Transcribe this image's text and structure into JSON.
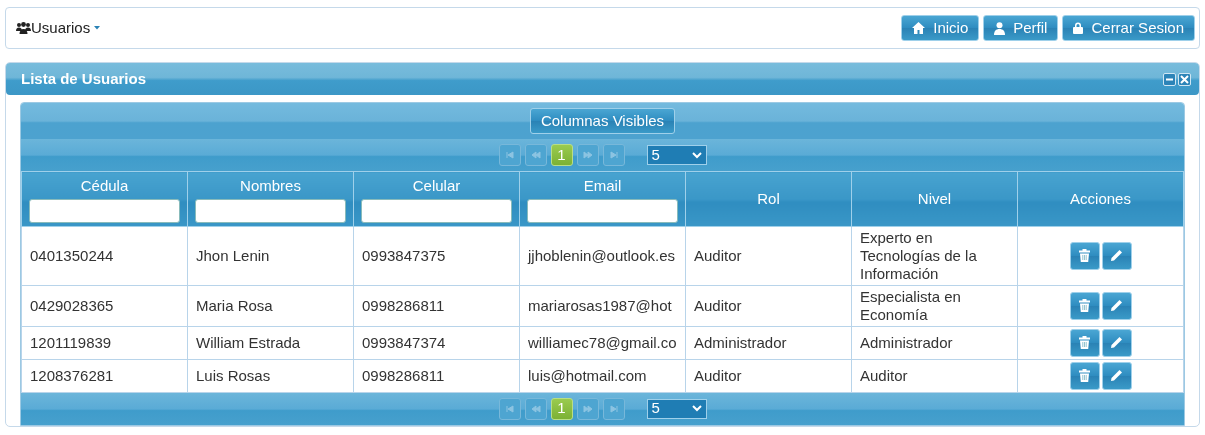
{
  "topbar": {
    "menu": {
      "label": "Usuarios"
    },
    "buttons": [
      {
        "kind": "home",
        "label": "Inicio"
      },
      {
        "kind": "user",
        "label": "Perfil"
      },
      {
        "kind": "lock",
        "label": "Cerrar Sesion"
      }
    ]
  },
  "panel": {
    "title": "Lista de Usuarios",
    "controls": [
      {
        "kind": "minimize"
      },
      {
        "kind": "close"
      }
    ]
  },
  "grid": {
    "toolbar_button": "Columnas Visibles",
    "top_pager": {
      "pages": [
        {
          "label": "1",
          "selected": true
        }
      ],
      "page_size": "5"
    },
    "columns": [
      {
        "label": "Cédula",
        "filter": true
      },
      {
        "label": "Nombres",
        "filter": true
      },
      {
        "label": "Celular",
        "filter": true
      },
      {
        "label": "Email",
        "filter": true
      },
      {
        "label": "Rol",
        "filter": false
      },
      {
        "label": "Nivel",
        "filter": false
      },
      {
        "label": "Acciones",
        "filter": false
      }
    ],
    "rows": [
      {
        "cells": [
          "0401350244",
          "Jhon Lenin",
          "0993847375",
          "jjhoblenin@outlook.es",
          "Auditor",
          "Experto en Tecnologías de la Información"
        ],
        "actions": [
          {
            "kind": "delete"
          },
          {
            "kind": "edit"
          }
        ]
      },
      {
        "cells": [
          "0429028365",
          "Maria Rosa",
          "0998286811",
          "mariarosas1987@hot",
          "Auditor",
          "Especialista en Economía"
        ],
        "actions": [
          {
            "kind": "delete"
          },
          {
            "kind": "edit"
          }
        ]
      },
      {
        "cells": [
          "1201119839",
          "William Estrada",
          "0993847374",
          "williamec78@gmail.co",
          "Administrador",
          "Administrador"
        ],
        "actions": [
          {
            "kind": "delete"
          },
          {
            "kind": "edit"
          }
        ]
      },
      {
        "cells": [
          "1208376281",
          "Luis Rosas",
          "0998286811",
          "luis@hotmail.com",
          "Auditor",
          "Auditor"
        ],
        "actions": [
          {
            "kind": "delete"
          },
          {
            "kind": "edit"
          }
        ]
      }
    ],
    "bottom_pager": {
      "pages": [
        {
          "label": "1",
          "selected": true
        }
      ],
      "page_size": "5"
    }
  }
}
